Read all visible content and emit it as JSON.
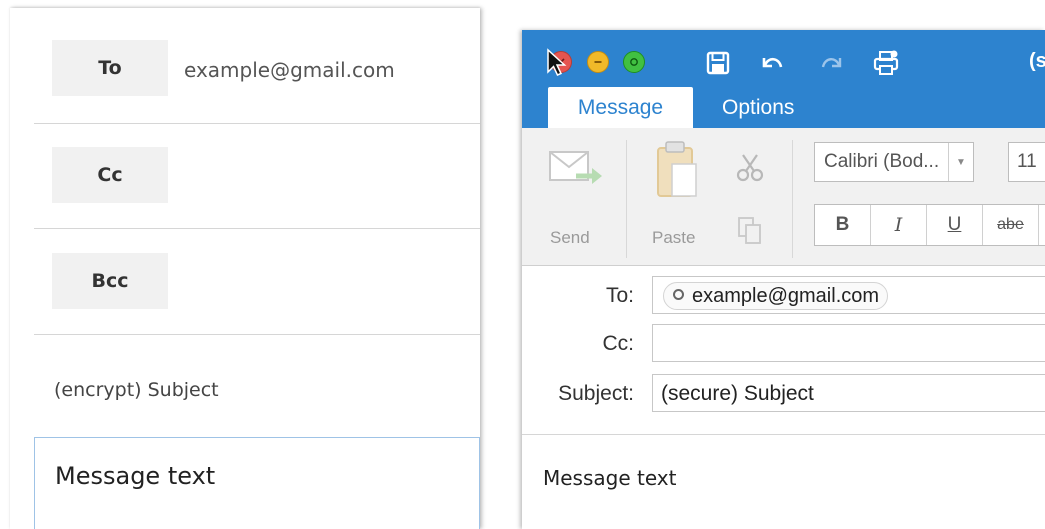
{
  "web_compose": {
    "to_button": "To",
    "to_value": "example@gmail.com",
    "cc_button": "Cc",
    "bcc_button": "Bcc",
    "subject": "(encrypt) Subject",
    "body": "Message text"
  },
  "outlook": {
    "title_truncated": "(s",
    "tabs": {
      "message": "Message",
      "options": "Options"
    },
    "ribbon": {
      "send_label": "Send",
      "paste_label": "Paste",
      "font_name": "Calibri (Bod...",
      "font_size": "11",
      "bold": "B",
      "italic": "I",
      "underline": "U",
      "strikethrough": "abe"
    },
    "headers": {
      "to_label": "To:",
      "to_recipient": "example@gmail.com",
      "cc_label": "Cc:",
      "subject_label": "Subject:",
      "subject_value": "(secure) Subject"
    },
    "body": "Message text",
    "colors": {
      "title_bar": "#2d83cf",
      "ribbon_bg": "#f1f1f1"
    }
  }
}
